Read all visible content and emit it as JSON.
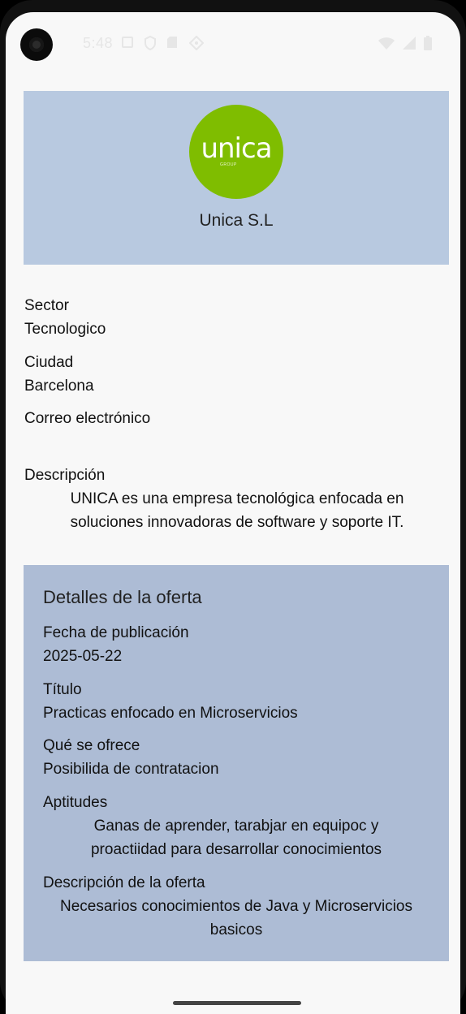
{
  "status_bar": {
    "time": "5:48",
    "left_icons": [
      "sim-icon",
      "shield-icon",
      "sd-card-icon",
      "location-icon"
    ],
    "right_icons": [
      "wifi-icon",
      "signal-icon",
      "battery-icon"
    ]
  },
  "company": {
    "logo_text": "unica",
    "logo_subtext": "GROUP",
    "logo_color": "#7fbd00",
    "name": "Unica S.L"
  },
  "details": {
    "sector_label": "Sector",
    "sector_value": "Tecnologico",
    "city_label": "Ciudad",
    "city_value": "Barcelona",
    "email_label": "Correo electrónico",
    "email_value": "",
    "description_label": "Descripción",
    "description_line1": "UNICA es una empresa tecnológica enfocada en",
    "description_line2": "soluciones innovadoras de software y soporte IT."
  },
  "offer": {
    "title": "Detalles de la oferta",
    "date_label": "Fecha de publicación",
    "date_value": "2025-05-22",
    "job_title_label": "Título",
    "job_title_value": "Practicas enfocado en Microservicios",
    "offers_label": "Qué se ofrece",
    "offers_value": "Posibilida de contratacion",
    "skills_label": "Aptitudes",
    "skills_line1": "Ganas de aprender, tarabjar en equipoc y",
    "skills_line2": "proactiidad para desarrollar conocimientos",
    "offer_desc_label": "Descripción de la oferta",
    "offer_desc_line1": "Necesarios conocimientos de Java y Microservicios",
    "offer_desc_line2": "basicos"
  },
  "colors": {
    "header_bg": "#b8c9e0",
    "offer_bg": "#adbcd5",
    "screen_bg": "#f8f8f8"
  }
}
